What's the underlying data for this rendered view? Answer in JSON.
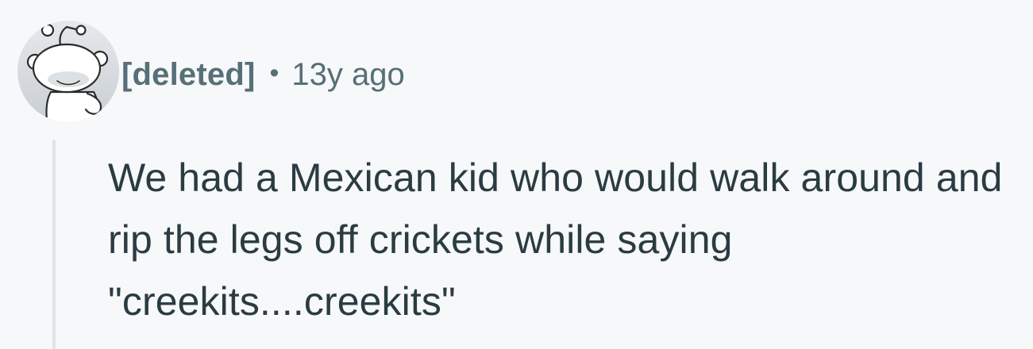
{
  "comment": {
    "author": "[deleted]",
    "separator": "•",
    "timestamp": "13y ago",
    "body": "We had a Mexican kid who would walk around and rip the legs off crickets while saying \"creekits....creekits\"",
    "avatar_icon": "snoo-avatar-icon"
  }
}
